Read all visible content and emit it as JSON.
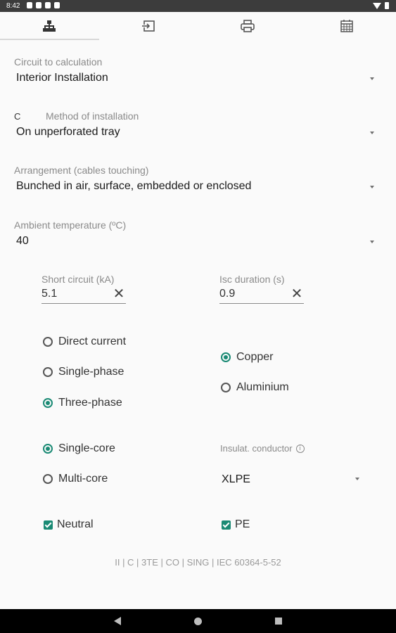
{
  "status_bar": {
    "time": "8:42"
  },
  "tabs": [
    {
      "icon": "hierarchy-icon",
      "active": true
    },
    {
      "icon": "login-icon",
      "active": false
    },
    {
      "icon": "print-icon",
      "active": false
    },
    {
      "icon": "calendar-icon",
      "active": false
    }
  ],
  "circuit": {
    "label": "Circuit to calculation",
    "value": "Interior Installation"
  },
  "method": {
    "prefix": "C",
    "label": "Method of installation",
    "value": "On unperforated tray"
  },
  "arrangement": {
    "label": "Arrangement (cables touching)",
    "value": "Bunched in air, surface, embedded or enclosed"
  },
  "ambient": {
    "label": "Ambient temperature (ºC)",
    "value": "40"
  },
  "short_circuit": {
    "label": "Short circuit (kA)",
    "value": "5.1"
  },
  "isc_duration": {
    "label": "Isc duration (s)",
    "value": "0.9"
  },
  "current_type": {
    "options": [
      "Direct current",
      "Single-phase",
      "Three-phase"
    ],
    "selected": "Three-phase"
  },
  "conductor_material": {
    "options": [
      "Copper",
      "Aluminium"
    ],
    "selected": "Copper"
  },
  "core_type": {
    "options": [
      "Single-core",
      "Multi-core"
    ],
    "selected": "Single-core"
  },
  "insulation": {
    "label": "Insulat. conductor",
    "value": "XLPE"
  },
  "checks": {
    "neutral": "Neutral",
    "pe": "PE"
  },
  "summary": "II | C | 3TE | CO | SING | IEC 60364-5-52",
  "colors": {
    "accent": "#1a8a74",
    "status_bar": "#3c3c3c",
    "background": "#fafafa"
  }
}
